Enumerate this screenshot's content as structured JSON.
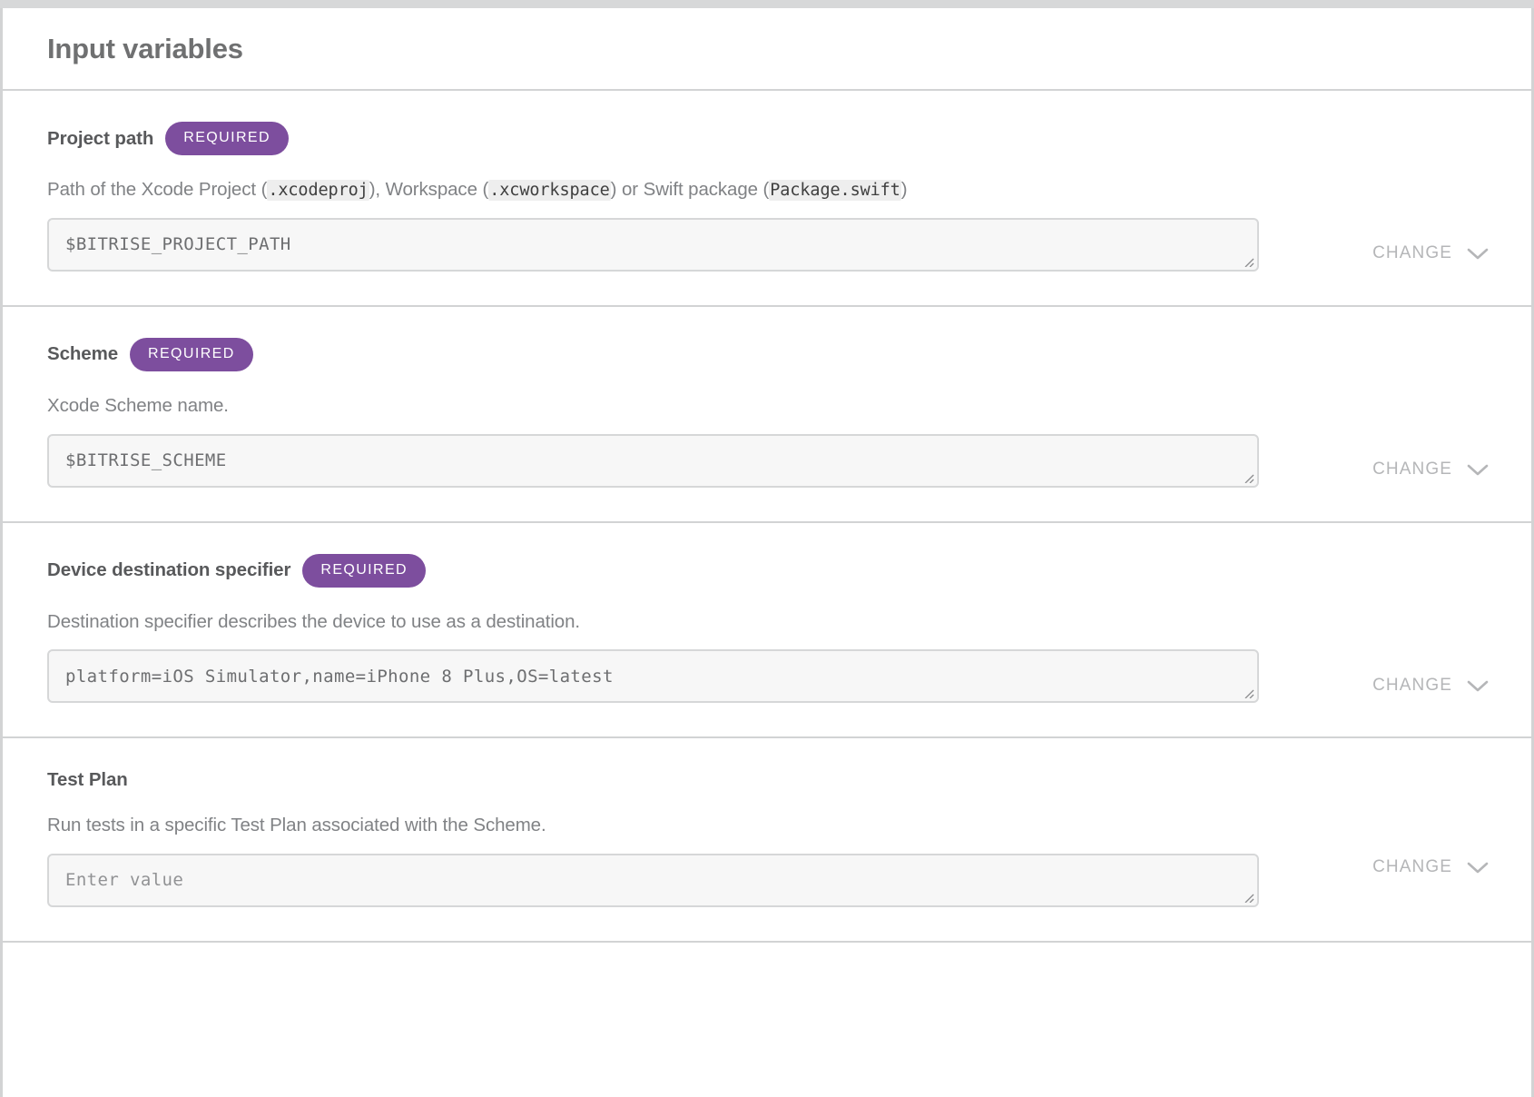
{
  "header": {
    "title": "Input variables"
  },
  "labels": {
    "required_badge": "REQUIRED",
    "change": "CHANGE"
  },
  "colors": {
    "badge_purple": "#7d4e9e",
    "title_gray": "#6f7071",
    "description_gray": "#808285",
    "change_gray": "#b5b6b8",
    "field_background": "#f7f7f7",
    "field_border": "#d6d7d8",
    "divider": "#d2d3d4",
    "code_background": "#eeeeee"
  },
  "icons": {
    "chevron_down": "chevron-down-icon",
    "resize_grip": "resize-grip-icon"
  },
  "variables": [
    {
      "name": "Project path",
      "required": true,
      "description_parts": [
        {
          "type": "text",
          "text": "Path of the Xcode Project ("
        },
        {
          "type": "code",
          "text": ".xcodeproj"
        },
        {
          "type": "text",
          "text": "), Workspace ("
        },
        {
          "type": "code",
          "text": ".xcworkspace"
        },
        {
          "type": "text",
          "text": ") or Swift package ("
        },
        {
          "type": "code",
          "text": "Package.swift"
        },
        {
          "type": "text",
          "text": ")"
        }
      ],
      "description_plain": "Path of the Xcode Project (.xcodeproj), Workspace (.xcworkspace) or Swift package (Package.swift)",
      "value": "$BITRISE_PROJECT_PATH",
      "placeholder": "",
      "is_placeholder": false
    },
    {
      "name": "Scheme",
      "required": true,
      "description_plain": "Xcode Scheme name.",
      "value": "$BITRISE_SCHEME",
      "placeholder": "",
      "is_placeholder": false
    },
    {
      "name": "Device destination specifier",
      "required": true,
      "description_plain": "Destination specifier describes the device to use as a destination.",
      "value": "platform=iOS Simulator,name=iPhone 8 Plus,OS=latest",
      "placeholder": "",
      "is_placeholder": false
    },
    {
      "name": "Test Plan",
      "required": false,
      "description_plain": "Run tests in a specific Test Plan associated with the Scheme.",
      "value": "",
      "placeholder": "Enter value",
      "is_placeholder": true
    }
  ]
}
